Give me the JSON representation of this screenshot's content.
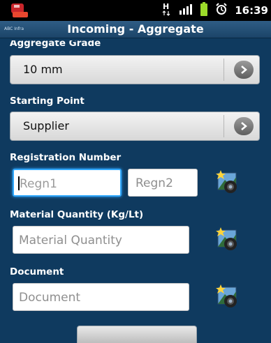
{
  "statusbar": {
    "time": "16:39",
    "icons": [
      "app-icon",
      "data-hplus-icon",
      "signal-icon",
      "battery-icon",
      "alarm-icon"
    ],
    "network_label": "H"
  },
  "titlebar": {
    "logo_text": "ABC Infra",
    "title": "Incoming - Aggregate"
  },
  "form": {
    "aggregate_grade": {
      "label": "Aggregate Grade",
      "value": "10 mm"
    },
    "starting_point": {
      "label": "Starting Point",
      "value": "Supplier"
    },
    "registration": {
      "label": "Registration Number",
      "regn1_placeholder": "Regn1",
      "regn2_placeholder": "Regn2"
    },
    "material_quantity": {
      "label": "Material Quantity (Kg/Lt)",
      "placeholder": "Material Quantity"
    },
    "document": {
      "label": "Document",
      "placeholder": "Document"
    }
  },
  "colors": {
    "background": "#0f3a5f",
    "titlebar": "#1b4468",
    "focus": "#2fa7ff"
  }
}
